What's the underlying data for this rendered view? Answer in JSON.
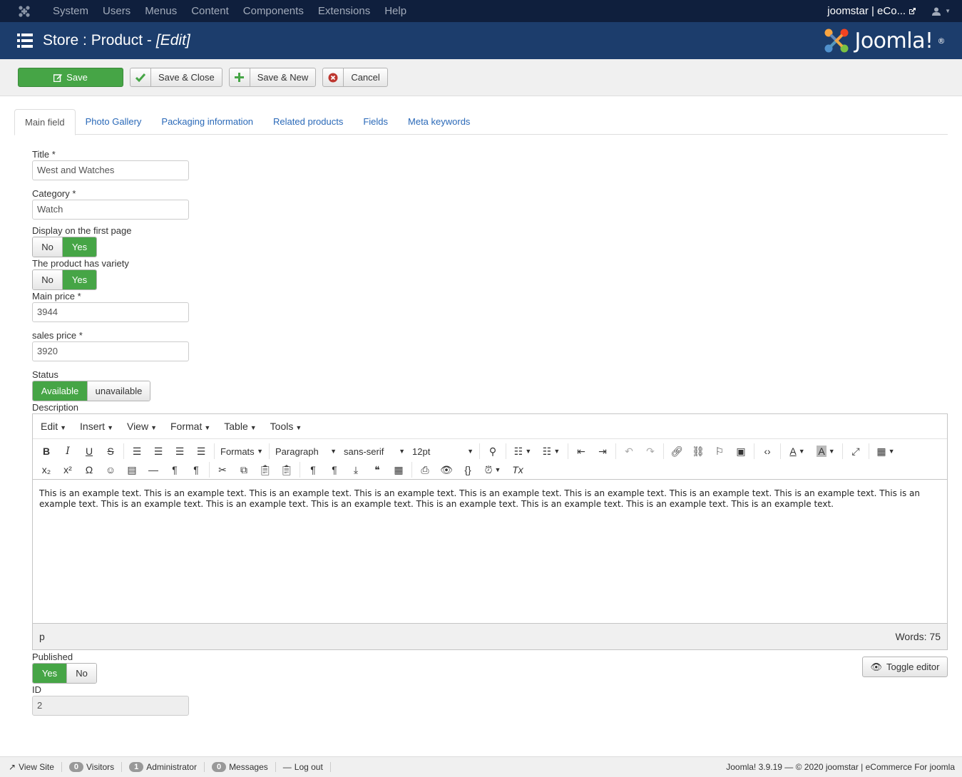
{
  "topbar": {
    "menu": [
      "System",
      "Users",
      "Menus",
      "Content",
      "Components",
      "Extensions",
      "Help"
    ],
    "site_name": "joomstar | eCo..."
  },
  "header": {
    "title": "Store : Product -",
    "title_suffix": "[Edit]",
    "brand": "Joomla!",
    "brand_mark": "®"
  },
  "toolbar": {
    "save": "Save",
    "save_close": "Save & Close",
    "save_new": "Save & New",
    "cancel": "Cancel"
  },
  "tabs": [
    "Main field",
    "Photo Gallery",
    "Packaging information",
    "Related products",
    "Fields",
    "Meta keywords"
  ],
  "form": {
    "title_label": "Title *",
    "title_value": "West and Watches",
    "category_label": "Category *",
    "category_value": "Watch",
    "first_page_label": "Display on the first page",
    "variety_label": "The product has variety",
    "no": "No",
    "yes": "Yes",
    "main_price_label": "Main price *",
    "main_price_value": "3944",
    "sales_price_label": "sales price *",
    "sales_price_value": "3920",
    "status_label": "Status",
    "status_available": "Available",
    "status_unavailable": "unavailable",
    "description_label": "Description",
    "published_label": "Published",
    "id_label": "ID",
    "id_value": "2"
  },
  "editor": {
    "menu": [
      "Edit",
      "Insert",
      "View",
      "Format",
      "Table",
      "Tools"
    ],
    "formats": "Formats",
    "block": "Paragraph",
    "font": "sans-serif",
    "size": "12pt",
    "content": "This is an example text. This is an example text. This is an example text. This is an example text. This is an example text. This is an example text. This is an example text. This is an example text. This is an example text. This is an example text. This is an example text. This is an example text. This is an example text. This is an example text. This is an example text. This is an example text.",
    "path": "p",
    "words": "Words: 75",
    "toggle": "Toggle editor"
  },
  "footer": {
    "view_site": "View Site",
    "visitors_count": "0",
    "visitors": "Visitors",
    "admin_count": "1",
    "admin": "Administrator",
    "messages_count": "0",
    "messages": "Messages",
    "logout": "Log out",
    "copyright": "Joomla! 3.9.19 — © 2020 joomstar | eCommerce For joomla"
  },
  "colors": {
    "topbar": "#0f1f3d",
    "header": "#1c3d6c",
    "success": "#46a546",
    "link": "#2a69b8"
  }
}
